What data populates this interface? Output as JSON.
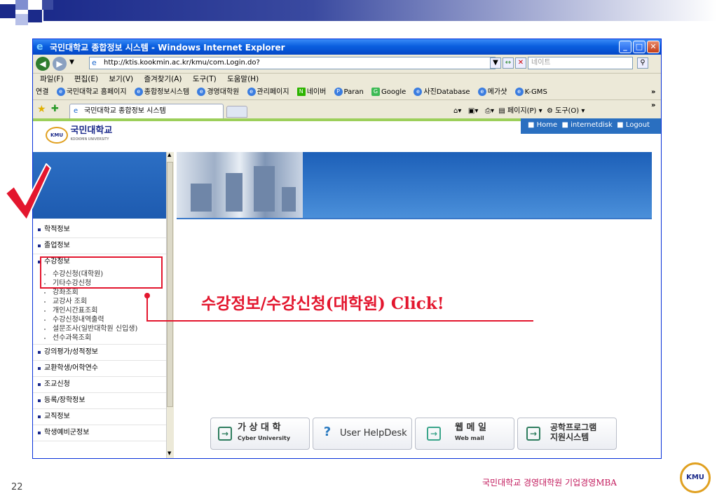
{
  "slide": {
    "number": "22",
    "footer": "국민대학교 경영대학원 기업경영MBA",
    "footer_logo": "KMU"
  },
  "window": {
    "title": "국민대학교 종합정보 시스템 - Windows Internet Explorer",
    "url": "http://ktis.kookmin.ac.kr/kmu/com.Login.do?",
    "search_placeholder": "네이트",
    "menu": [
      "파일(F)",
      "편집(E)",
      "보기(V)",
      "즐겨찾기(A)",
      "도구(T)",
      "도움말(H)"
    ],
    "links_label": "연결",
    "links": [
      "국민대학교 홈페이지",
      "종합정보시스템",
      "경영대학원",
      "관리페이지",
      "네이버",
      "Paran",
      "Google",
      "사진Database",
      "메가샷",
      "K-GMS"
    ],
    "tab": "국민대학교 종합정보 시스템",
    "commands": [
      "페이지(P)",
      "도구(O)"
    ]
  },
  "page": {
    "top_links": [
      "Home",
      "internetdisk",
      "Logout"
    ],
    "logo_text": "국민대학교",
    "logo_sub": "KOOKMIN UNIVERSITY",
    "logo_badge": "KMU",
    "menu": {
      "item1": "학적정보",
      "item2": "졸업정보",
      "item3": "수강정보",
      "sub": [
        "수강신청(대학원)",
        "기타수강신청",
        "강좌조회",
        "교강사 조회",
        "개인시간표조회",
        "수강신청내역출력",
        "설문조사(일반대학원 신입생)",
        "선수과목조회"
      ],
      "rest": [
        "강의평가/성적정보",
        "교환학생/어학연수",
        "조교신청",
        "등록/장학정보",
        "교직정보",
        "학생예비군정보"
      ]
    },
    "bottom_buttons": [
      {
        "title": "가 상 대 학",
        "sub": "Cyber University",
        "icon": "arrow-right-icon"
      },
      {
        "title": "User HelpDesk",
        "sub": "",
        "icon": "question-icon"
      },
      {
        "title": "웹 메 일",
        "sub": "Web mail",
        "icon": "arrow-right-icon"
      },
      {
        "title": "공학프로그램",
        "sub": "지원시스템",
        "icon": "arrow-right-icon"
      }
    ]
  },
  "annotation": {
    "text": "수강정보/수강신청(대학원) Click!",
    "color": "#e3162e"
  }
}
